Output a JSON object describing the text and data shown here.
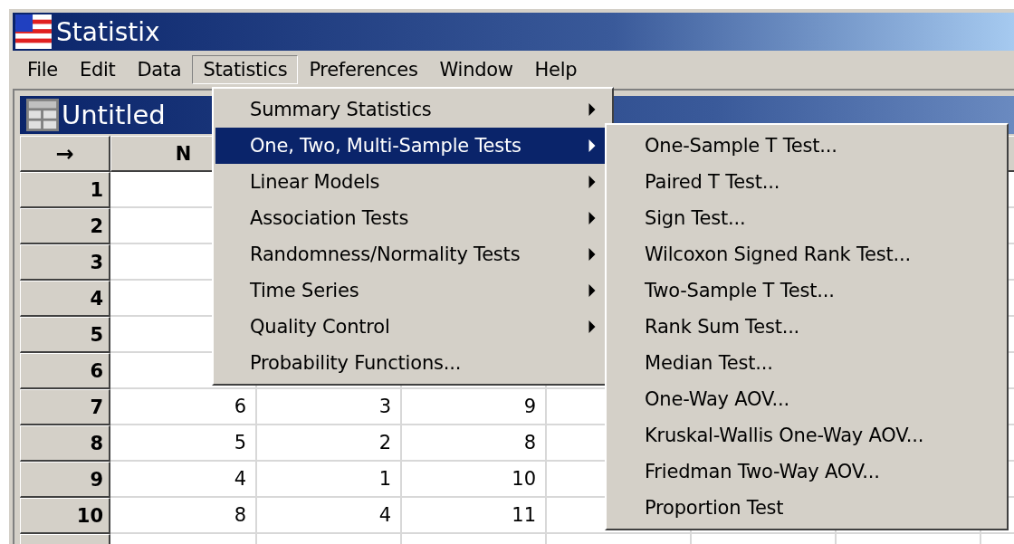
{
  "window": {
    "title": "Statistix"
  },
  "menubar": [
    {
      "label": "File",
      "selected": false
    },
    {
      "label": "Edit",
      "selected": false
    },
    {
      "label": "Data",
      "selected": false
    },
    {
      "label": "Statistics",
      "selected": true
    },
    {
      "label": "Preferences",
      "selected": false
    },
    {
      "label": "Window",
      "selected": false
    },
    {
      "label": "Help",
      "selected": false
    }
  ],
  "child_window": {
    "title": "Untitled"
  },
  "grid": {
    "corner": "→",
    "columns": [
      "N"
    ],
    "rows": [
      {
        "label": "1",
        "cells": []
      },
      {
        "label": "2",
        "cells": []
      },
      {
        "label": "3",
        "cells": []
      },
      {
        "label": "4",
        "cells": []
      },
      {
        "label": "5",
        "cells": []
      },
      {
        "label": "6",
        "cells": []
      },
      {
        "label": "7",
        "cells": [
          "6",
          "3",
          "9"
        ]
      },
      {
        "label": "8",
        "cells": [
          "5",
          "2",
          "8"
        ]
      },
      {
        "label": "9",
        "cells": [
          "4",
          "1",
          "10"
        ]
      },
      {
        "label": "10",
        "cells": [
          "8",
          "4",
          "11"
        ]
      }
    ]
  },
  "menu": {
    "items": [
      {
        "label": "Summary Statistics",
        "submenu": true,
        "selected": false
      },
      {
        "label": "One, Two, Multi-Sample Tests",
        "submenu": true,
        "selected": true
      },
      {
        "label": "Linear Models",
        "submenu": true,
        "selected": false
      },
      {
        "label": "Association Tests",
        "submenu": true,
        "selected": false
      },
      {
        "label": "Randomness/Normality Tests",
        "submenu": true,
        "selected": false
      },
      {
        "label": "Time Series",
        "submenu": true,
        "selected": false
      },
      {
        "label": "Quality Control",
        "submenu": true,
        "selected": false
      },
      {
        "label": "Probability Functions...",
        "submenu": false,
        "selected": false
      }
    ]
  },
  "submenu": {
    "items": [
      {
        "label": "One-Sample T Test..."
      },
      {
        "label": "Paired T Test..."
      },
      {
        "label": "Sign Test..."
      },
      {
        "label": "Wilcoxon Signed Rank Test..."
      },
      {
        "label": "Two-Sample T Test..."
      },
      {
        "label": "Rank Sum Test..."
      },
      {
        "label": "Median Test..."
      },
      {
        "label": "One-Way AOV..."
      },
      {
        "label": "Kruskal-Wallis One-Way AOV..."
      },
      {
        "label": "Friedman Two-Way AOV..."
      },
      {
        "label": "Proportion Test"
      }
    ]
  }
}
